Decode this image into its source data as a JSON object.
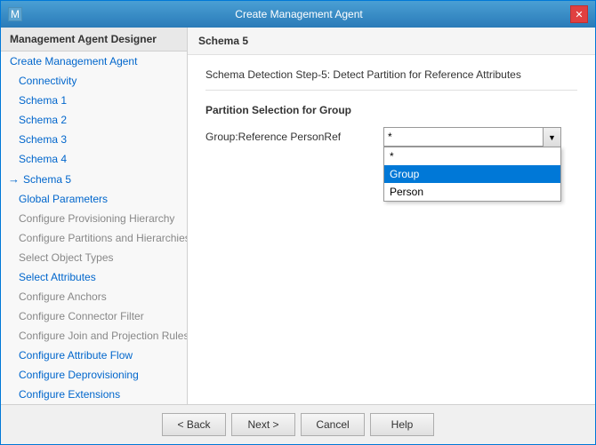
{
  "window": {
    "title": "Create Management Agent",
    "close_label": "✕",
    "icon_label": "M"
  },
  "sidebar": {
    "header": "Management Agent Designer",
    "items": [
      {
        "id": "create-management-agent",
        "label": "Create Management Agent",
        "indent": false,
        "active": false,
        "grayed": false
      },
      {
        "id": "connectivity",
        "label": "Connectivity",
        "indent": true,
        "active": false,
        "grayed": false
      },
      {
        "id": "schema-1",
        "label": "Schema 1",
        "indent": true,
        "active": false,
        "grayed": false
      },
      {
        "id": "schema-2",
        "label": "Schema 2",
        "indent": true,
        "active": false,
        "grayed": false
      },
      {
        "id": "schema-3",
        "label": "Schema 3",
        "indent": true,
        "active": false,
        "grayed": false
      },
      {
        "id": "schema-4",
        "label": "Schema 4",
        "indent": true,
        "active": false,
        "grayed": false
      },
      {
        "id": "schema-5",
        "label": "Schema 5",
        "indent": true,
        "active": true,
        "grayed": false
      },
      {
        "id": "global-parameters",
        "label": "Global Parameters",
        "indent": true,
        "active": false,
        "grayed": false
      },
      {
        "id": "configure-provisioning-hierarchy",
        "label": "Configure Provisioning Hierarchy",
        "indent": true,
        "active": false,
        "grayed": true
      },
      {
        "id": "configure-partitions-and-hierarchies",
        "label": "Configure Partitions and Hierarchies",
        "indent": true,
        "active": false,
        "grayed": true
      },
      {
        "id": "select-object-types",
        "label": "Select Object Types",
        "indent": true,
        "active": false,
        "grayed": true
      },
      {
        "id": "select-attributes",
        "label": "Select Attributes",
        "indent": true,
        "active": false,
        "grayed": false
      },
      {
        "id": "configure-anchors",
        "label": "Configure Anchors",
        "indent": true,
        "active": false,
        "grayed": true
      },
      {
        "id": "configure-connector-filter",
        "label": "Configure Connector Filter",
        "indent": true,
        "active": false,
        "grayed": true
      },
      {
        "id": "configure-join-and-projection-rules",
        "label": "Configure Join and Projection Rules",
        "indent": true,
        "active": false,
        "grayed": true
      },
      {
        "id": "configure-attribute-flow",
        "label": "Configure Attribute Flow",
        "indent": true,
        "active": false,
        "grayed": false
      },
      {
        "id": "configure-deprovisioning",
        "label": "Configure Deprovisioning",
        "indent": true,
        "active": false,
        "grayed": false
      },
      {
        "id": "configure-extensions",
        "label": "Configure Extensions",
        "indent": true,
        "active": false,
        "grayed": false
      }
    ]
  },
  "main": {
    "header": "Schema 5",
    "step_description": "Schema Detection Step-5: Detect Partition for Reference Attributes",
    "partition_title": "Partition Selection for Group",
    "field_label": "Group:Reference PersonRef",
    "dropdown": {
      "value": "*",
      "options": [
        {
          "label": "*",
          "value": "*"
        },
        {
          "label": "Group",
          "value": "Group"
        },
        {
          "label": "Person",
          "value": "Person"
        }
      ],
      "open": true,
      "highlighted": "Group"
    }
  },
  "footer": {
    "back_label": "< Back",
    "next_label": "Next >",
    "cancel_label": "Cancel",
    "help_label": "Help"
  }
}
